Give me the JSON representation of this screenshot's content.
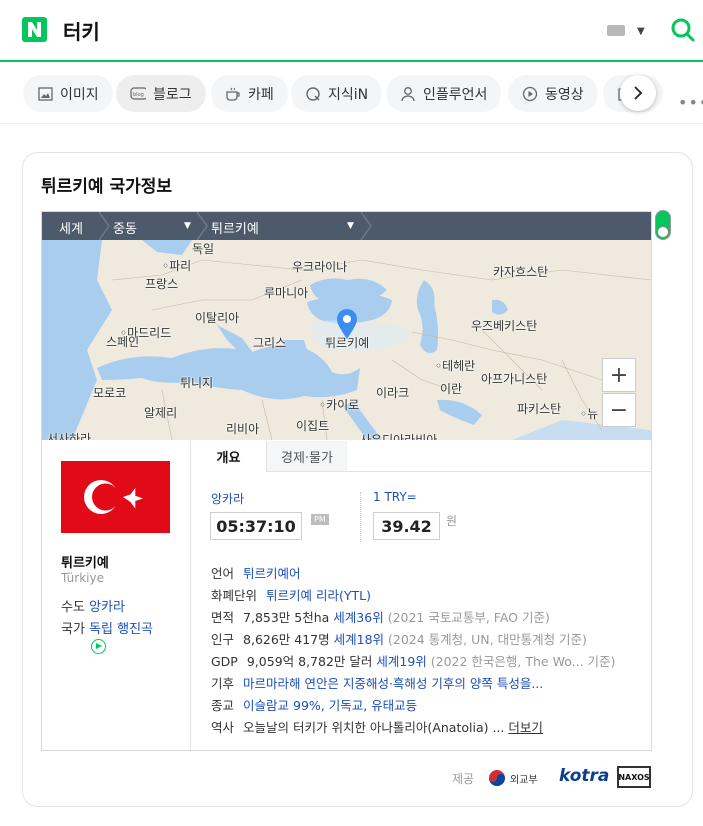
{
  "search": {
    "query": "터키",
    "logo": "N"
  },
  "tabs": [
    {
      "label": "이미지",
      "icon": "image-icon"
    },
    {
      "label": "블로그",
      "icon": "blog-icon"
    },
    {
      "label": "카페",
      "icon": "cafe-icon"
    },
    {
      "label": "지식iN",
      "icon": "kin-icon"
    },
    {
      "label": "인플루언서",
      "icon": "person-icon"
    },
    {
      "label": "동영상",
      "icon": "play-icon"
    }
  ],
  "card": {
    "title": "튀르키예 국가정보",
    "breadcrumb": [
      "세계",
      "중동",
      "튀르키예"
    ],
    "map_labels": {
      "france": "프랑스",
      "paris": "◦파리",
      "germany": "독일",
      "ukraine": "우크라이나",
      "kazakhstan": "카자흐스탄",
      "romania": "루마니아",
      "madrid": "◦마드리드",
      "spain": "스페인",
      "italy": "이탈리아",
      "greece": "그리스",
      "turkiye": "튀르키예",
      "uzbekistan": "우즈베키스탄",
      "tehran": "◦테헤란",
      "morocco": "모로코",
      "tunisia": "튀니지",
      "iran": "이란",
      "afghanistan": "아프가니스탄",
      "iraq": "이라크",
      "cairo": "◦카이로",
      "algeria": "알제리",
      "pakistan": "파키스탄",
      "newdelhi": "◦뉴",
      "libya": "리비아",
      "egypt": "이집트",
      "wsahara": "서사하라",
      "saudi": "사우디아라비아"
    },
    "country": {
      "name_ko": "튀르키예",
      "name_en": "Türkiye",
      "capital_label": "수도",
      "capital": "앙카라",
      "anthem_label": "국가",
      "anthem": "독립 행진곡"
    },
    "info_tabs": [
      "개요",
      "경제·물가"
    ],
    "time": {
      "city": "앙카라",
      "value": "05:37:10",
      "ampm": "PM"
    },
    "rate": {
      "label": "1 TRY=",
      "value": "39.42",
      "unit": "원"
    },
    "rows": [
      {
        "key": "언어",
        "value": "튀르키예어"
      },
      {
        "key": "화폐단위",
        "value": "튀르키예 리라(YTL)"
      },
      {
        "key": "면적",
        "value": "7,853만 5천ha",
        "rank": "세계36위",
        "note": "(2021 국토교통부, FAO 기준)"
      },
      {
        "key": "인구",
        "value": "8,626만 417명",
        "rank": "세계18위",
        "note": "(2024 통계청, UN, 대만통계청 기준)"
      },
      {
        "key": "GDP",
        "value": "9,059억 8,782만 달러",
        "rank": "세계19위",
        "note": "(2022 한국은행, The Wo... 기준)"
      },
      {
        "key": "기후",
        "value": "마르마라해 연안은 지중해성·흑해성 기후의 양쪽 특성을..."
      },
      {
        "key": "종교",
        "value": "이슬람교 99%, 기독교, 유태교등"
      },
      {
        "key": "역사",
        "value": "오늘날의 터키가 위치한 아나톨리아(Anatolia) ...",
        "more": "더보기"
      }
    ],
    "footer": {
      "source_label": "제공",
      "mofa": "외교부",
      "kotra": "kotra",
      "naxos": "NAXOS"
    }
  },
  "colors": {
    "brand": "#03c75a",
    "link": "#1d4fb8",
    "flag": "#e30a17",
    "breadcrumb_bg": "#4d5a6b",
    "pin": "#3b8ef0"
  }
}
